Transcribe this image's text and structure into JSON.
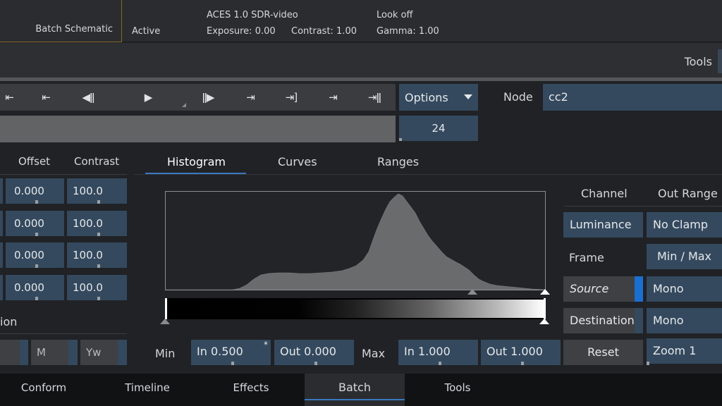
{
  "header": {
    "tab_label": "Batch Schematic",
    "status": "Active",
    "colorspace": "ACES 1.0 SDR-video",
    "look": "Look off",
    "exposure": "Exposure: 0.00",
    "contrast": "Contrast: 1.00",
    "gamma": "Gamma: 1.00"
  },
  "toolstrip": {
    "tools_label": "Tools"
  },
  "transport": {
    "buttons": [
      "⇤",
      "⇤",
      "◀ǁ",
      "▶",
      "ǁ▶",
      "⇥",
      "⇥]",
      "⇥",
      "⇥ǁ"
    ],
    "options_label": "Options",
    "node_label": "Node",
    "node_value": "cc2",
    "frame_value": "24"
  },
  "columns": {
    "offset_header": "Offset",
    "contrast_header": "Contrast",
    "offset_values": [
      "0.000",
      "0.000",
      "0.000",
      "0.000"
    ],
    "contrast_values": [
      "100.0",
      "100.0",
      "100.0",
      "100.0"
    ],
    "section_label": "ion",
    "m_button": "M",
    "yw_button": "Yw"
  },
  "tabs": {
    "histogram": "Histogram",
    "curves": "Curves",
    "ranges": "Ranges",
    "active": "Histogram"
  },
  "levels": {
    "min_label": "Min",
    "max_label": "Max",
    "min_in": "In 0.500",
    "min_in_modified": "*",
    "min_out": "Out 0.000",
    "max_in": "In 1.000",
    "max_out": "Out 1.000"
  },
  "right_panel": {
    "channel_header": "Channel",
    "out_range_header": "Out Range",
    "channel_value": "Luminance",
    "out_range_value": "No Clamp",
    "frame_label": "Frame",
    "frame_value": "Min / Max",
    "source_button": "Source",
    "source_value": "Mono",
    "destination_button": "Destination",
    "destination_value": "Mono",
    "reset_button": "Reset",
    "zoom_value": "Zoom 1"
  },
  "navbar": {
    "items": [
      "Conform",
      "Timeline",
      "Effects",
      "Batch",
      "Tools"
    ],
    "active": "Batch"
  },
  "colors": {
    "accent": "#3a78c0",
    "field_blue": "#34495e",
    "source_active": "#1a6fd0"
  }
}
